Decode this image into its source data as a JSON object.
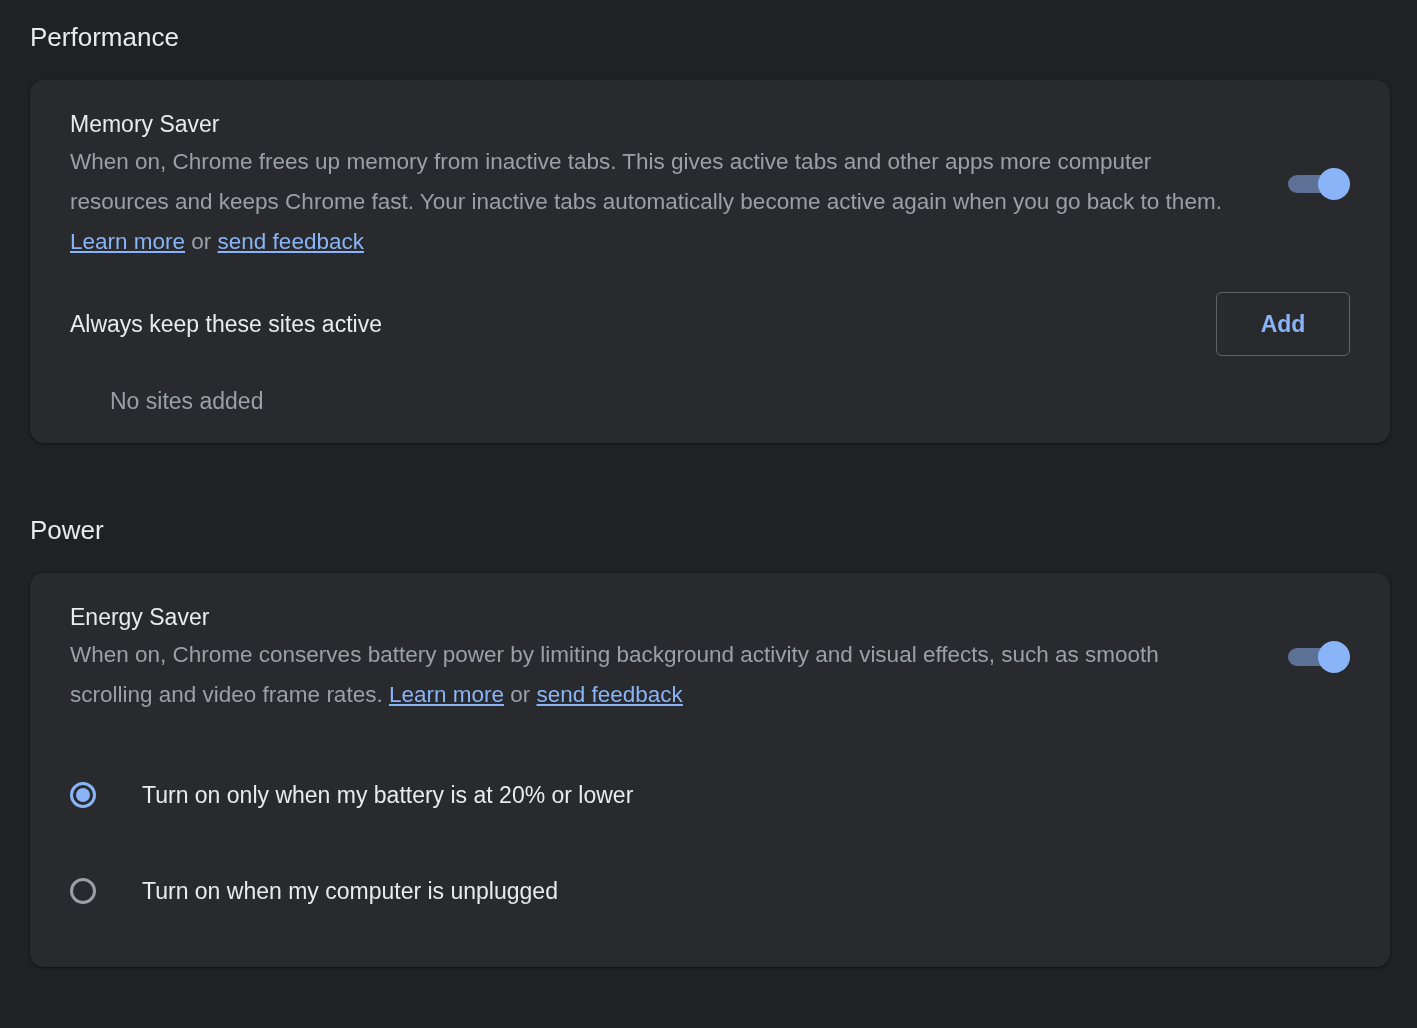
{
  "sections": [
    {
      "title": "Performance",
      "card": {
        "title": "Memory Saver",
        "on": true,
        "description": [
          {
            "kind": "text",
            "text": "When on, Chrome frees up memory from inactive tabs. This gives active tabs and other apps more computer resources and keeps Chrome fast. Your inactive tabs automatically become active again when you go back to them. "
          },
          {
            "kind": "link",
            "text": "Learn more"
          },
          {
            "kind": "text",
            "text": " or "
          },
          {
            "kind": "link",
            "text": "send feedback"
          }
        ],
        "sites": {
          "label": "Always keep these sites active",
          "button": "Add",
          "empty": "No sites added"
        }
      }
    },
    {
      "title": "Power",
      "card": {
        "title": "Energy Saver",
        "on": true,
        "description": [
          {
            "kind": "text",
            "text": "When on, Chrome conserves battery power by limiting background activity and visual effects, such as smooth scrolling and video frame rates. "
          },
          {
            "kind": "link",
            "text": "Learn more"
          },
          {
            "kind": "text",
            "text": " or "
          },
          {
            "kind": "link",
            "text": "send feedback"
          }
        ],
        "options": [
          {
            "label": "Turn on only when my battery is at 20% or lower",
            "selected": true
          },
          {
            "label": "Turn on when my computer is unplugged",
            "selected": false
          }
        ]
      }
    }
  ]
}
